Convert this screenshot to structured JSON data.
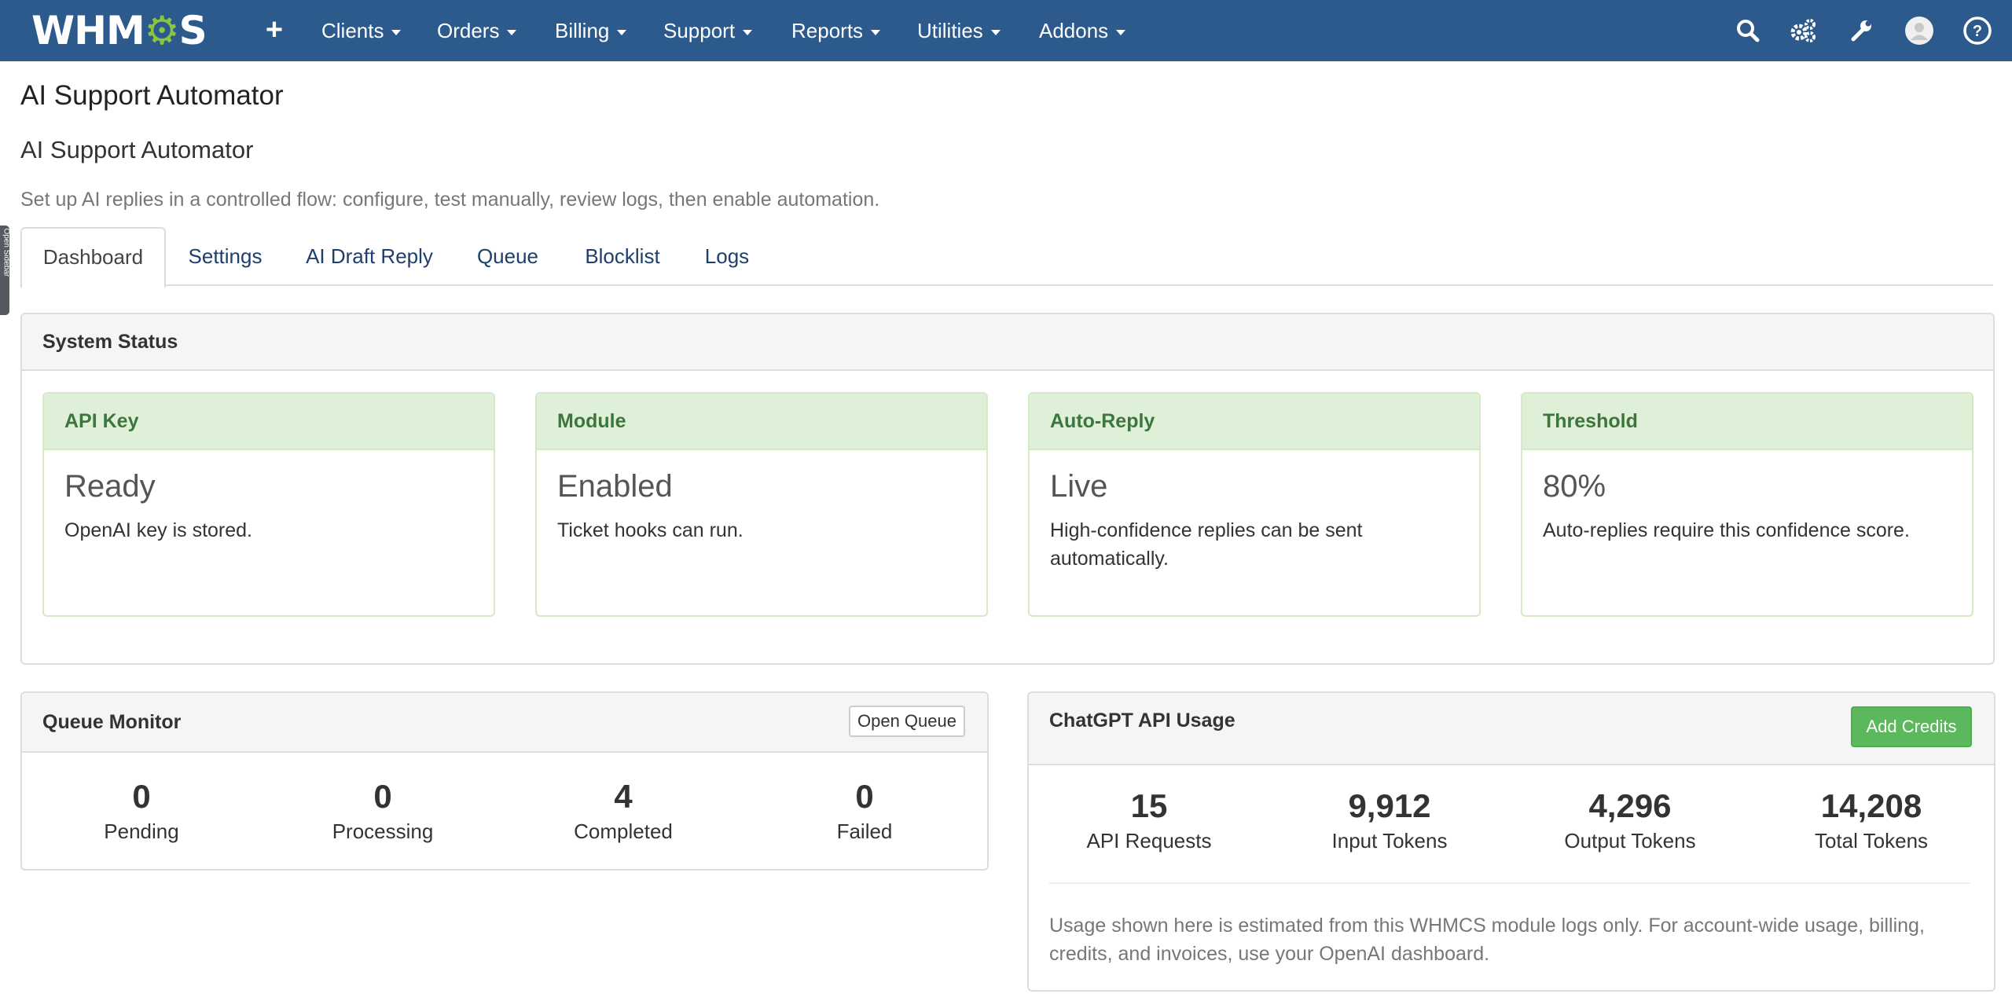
{
  "nav": {
    "logo_prefix": "WHM",
    "logo_gear": "⚙",
    "logo_suffix": "S",
    "plus": "+",
    "items": [
      {
        "label": "Clients"
      },
      {
        "label": "Orders"
      },
      {
        "label": "Billing"
      },
      {
        "label": "Support"
      },
      {
        "label": "Reports"
      },
      {
        "label": "Utilities"
      },
      {
        "label": "Addons"
      }
    ],
    "icons": [
      "search-icon",
      "gears-icon",
      "wrench-icon",
      "avatar-icon",
      "help-icon"
    ]
  },
  "sidebar_tab": {
    "label": "Open Sidebar"
  },
  "page": {
    "title": "AI Support Automator",
    "module_title": "AI Support Automator",
    "subtitle": "Set up AI replies in a controlled flow: configure, test manually, review logs, then enable automation."
  },
  "tabs": [
    {
      "label": "Dashboard",
      "active": true
    },
    {
      "label": "Settings"
    },
    {
      "label": "AI Draft Reply"
    },
    {
      "label": "Queue"
    },
    {
      "label": "Blocklist"
    },
    {
      "label": "Logs"
    }
  ],
  "system_status": {
    "title": "System Status",
    "cards": [
      {
        "head": "API Key",
        "value": "Ready",
        "desc": "OpenAI key is stored."
      },
      {
        "head": "Module",
        "value": "Enabled",
        "desc": "Ticket hooks can run."
      },
      {
        "head": "Auto-Reply",
        "value": "Live",
        "desc": "High-confidence replies can be sent automatically."
      },
      {
        "head": "Threshold",
        "value": "80%",
        "desc": "Auto-replies require this confidence score."
      }
    ]
  },
  "queue_monitor": {
    "title": "Queue Monitor",
    "button": "Open Queue",
    "stats": [
      {
        "value": "0",
        "label": "Pending"
      },
      {
        "value": "0",
        "label": "Processing"
      },
      {
        "value": "4",
        "label": "Completed"
      },
      {
        "value": "0",
        "label": "Failed"
      }
    ]
  },
  "api_usage": {
    "title": "ChatGPT API Usage",
    "button": "Add Credits",
    "stats": [
      {
        "value": "15",
        "label": "API Requests"
      },
      {
        "value": "9,912",
        "label": "Input Tokens"
      },
      {
        "value": "4,296",
        "label": "Output Tokens"
      },
      {
        "value": "14,208",
        "label": "Total Tokens"
      }
    ],
    "note": "Usage shown here is estimated from this WHMCS module logs only. For account-wide usage, billing, credits, and invoices, use your OpenAI dashboard."
  },
  "colors": {
    "nav_bg": "#2d5a8c",
    "logo_gear": "#8cc63f",
    "card_head_bg": "#dff0d8",
    "card_head_text": "#3c763d",
    "success_button": "#5cb85c"
  }
}
